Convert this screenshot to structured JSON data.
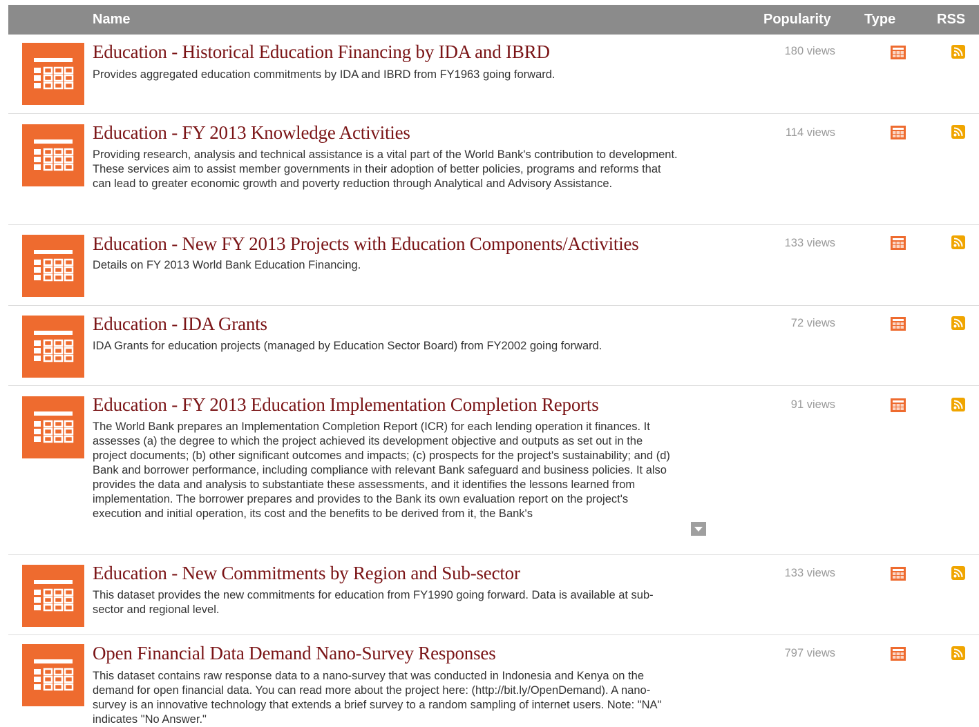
{
  "header": {
    "name": "Name",
    "popularity": "Popularity",
    "type": "Type",
    "rss": "RSS"
  },
  "icons": {
    "dataset": "table-dataset-icon",
    "type": "table-type-icon",
    "rss": "rss-feed-icon"
  },
  "colors": {
    "accent": "#ee6b2f",
    "title": "#7a1416",
    "header_bg": "#8b8b8b"
  },
  "datasets": [
    {
      "title": "Education - Historical Education Financing by IDA and IBRD",
      "description": "Provides aggregated education commitments by IDA and IBRD from FY1963 going forward.",
      "views": "180 views"
    },
    {
      "title": "Education - FY 2013 Knowledge Activities",
      "description": "Providing research, analysis and technical assistance is a vital part of the World Bank's contribution to development. These services aim to assist member governments in their adoption of better policies, programs and reforms that can lead to greater economic growth and poverty reduction through Analytical and Advisory Assistance.",
      "views": "114 views"
    },
    {
      "title": "Education - New FY 2013 Projects with Education Components/Activities",
      "description": "Details on FY 2013 World Bank Education Financing.",
      "views": "133 views"
    },
    {
      "title": "Education - IDA Grants",
      "description": "IDA Grants for education projects (managed by Education Sector Board) from FY2002 going forward.",
      "views": "72 views"
    },
    {
      "title": "Education - FY 2013 Education Implementation Completion Reports",
      "description": "The World Bank prepares an Implementation Completion Report (ICR) for each lending operation it finances. It assesses (a) the degree to which the project achieved its development objective and outputs as set out in the project documents; (b) other significant outcomes and impacts; (c) prospects for the project's sustainability; and (d) Bank and borrower performance, including compliance with relevant Bank safeguard and business policies. It also provides the data and analysis to substantiate these assessments, and it identifies the lessons learned from implementation. The borrower prepares and provides to the Bank its own evaluation report on the project's execution and initial operation, its cost and the benefits to be derived from it, the Bank's",
      "views": "91 views"
    },
    {
      "title": "Education - New Commitments by Region and Sub-sector",
      "description": "This dataset provides the new commitments for education from FY1990 going forward. Data is available at sub-sector and regional level.",
      "views": "133 views"
    },
    {
      "title": "Open Financial Data Demand Nano-Survey Responses",
      "description": "This dataset contains raw response data to a nano-survey that was conducted in Indonesia and Kenya on the demand for open financial data. You can read more about the project here: (http://bit.ly/OpenDemand). A nano-survey is an innovative technology that extends a brief survey to a random sampling of internet users. Note: \"NA\" indicates \"No Answer.\"",
      "views": "797 views"
    }
  ]
}
